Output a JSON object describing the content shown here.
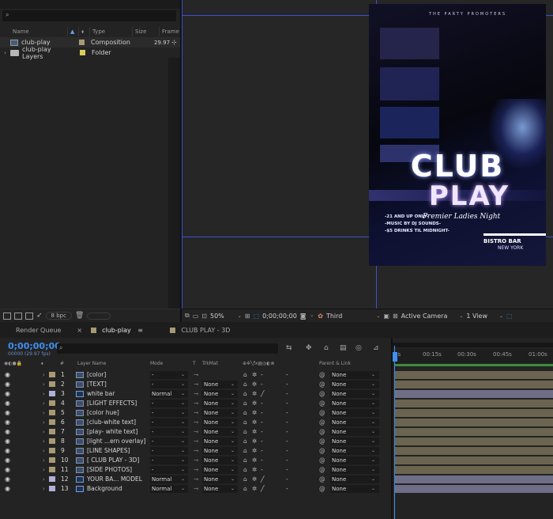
{
  "project": {
    "search_placeholder": "",
    "columns": {
      "name": "Name",
      "type": "Type",
      "size": "Size",
      "frame_rate": "Frame Ra..."
    },
    "items": [
      {
        "name": "club-play",
        "color": "#a89a74",
        "type": "Composition",
        "frame_rate": "29.97",
        "icon": "composition-icon"
      },
      {
        "name": "club-play Layers",
        "color": "#d8cf58",
        "type": "Folder",
        "frame_rate": "",
        "icon": "folder-icon"
      }
    ],
    "bpc": "8 bpc"
  },
  "viewer": {
    "zoom": "50%",
    "timecode": "0;00;00;00",
    "resolution": "Third",
    "camera": "Active Camera",
    "views": "1 View"
  },
  "poster": {
    "promoter": "THE PARTY PROMOTERS",
    "club": "CLUB",
    "play": "PLAY",
    "subtitle": "Premier Ladies Night",
    "line1": "-21 AND UP ONLY-",
    "line2": "-MUSIC BY DJ SOUNDS-",
    "line3": "-$5 DRINKS TIL MIDNIGHT-",
    "venue": "BISTRO BAR",
    "city": "NEW YORK"
  },
  "tabs": [
    {
      "label": "Render Queue",
      "color": "",
      "active": false
    },
    {
      "label": "club-play",
      "color": "#a89a74",
      "active": true
    },
    {
      "label": "CLUB PLAY - 3D",
      "color": "#a89a74",
      "active": false
    }
  ],
  "timeline": {
    "timecode": "0;00;00;00",
    "frames": "00000 (29.97 fps)",
    "headers": {
      "num": "#",
      "layer_name": "Layer Name",
      "mode": "Mode",
      "t": "T",
      "trkmat": "TrkMat",
      "parent": "Parent & Link"
    },
    "ruler": [
      "0s",
      "00:15s",
      "00:30s",
      "00:45s",
      "01:00s"
    ],
    "layers": [
      {
        "num": "1",
        "name": "[color]",
        "mode": "-",
        "trkmat": "",
        "parent": "None",
        "color": "#a89a74",
        "icon": "comp"
      },
      {
        "num": "2",
        "name": "[TEXT]",
        "mode": "-",
        "trkmat": "None",
        "parent": "None",
        "color": "#a89a74",
        "icon": "comp"
      },
      {
        "num": "3",
        "name": "white bar",
        "mode": "Normal",
        "trkmat": "None",
        "parent": "None",
        "color": "#b0b0d8",
        "icon": "text"
      },
      {
        "num": "4",
        "name": "[LIGHT EFFECTS]",
        "mode": "-",
        "trkmat": "None",
        "parent": "None",
        "color": "#a89a74",
        "icon": "comp"
      },
      {
        "num": "5",
        "name": "[color hue]",
        "mode": "-",
        "trkmat": "None",
        "parent": "None",
        "color": "#a89a74",
        "icon": "comp"
      },
      {
        "num": "6",
        "name": "[club-white text]",
        "mode": "-",
        "trkmat": "None",
        "parent": "None",
        "color": "#a89a74",
        "icon": "comp"
      },
      {
        "num": "7",
        "name": "[play- white text]",
        "mode": "-",
        "trkmat": "None",
        "parent": "None",
        "color": "#a89a74",
        "icon": "comp"
      },
      {
        "num": "8",
        "name": "[light ...ern overlay]",
        "mode": "-",
        "trkmat": "None",
        "parent": "None",
        "color": "#a89a74",
        "icon": "comp"
      },
      {
        "num": "9",
        "name": "[LINE SHAPES]",
        "mode": "-",
        "trkmat": "None",
        "parent": "None",
        "color": "#a89a74",
        "icon": "comp"
      },
      {
        "num": "10",
        "name": "[ CLUB PLAY - 3D]",
        "mode": "-",
        "trkmat": "None",
        "parent": "None",
        "color": "#a89a74",
        "icon": "comp"
      },
      {
        "num": "11",
        "name": "[SIDE PHOTOS]",
        "mode": "-",
        "trkmat": "None",
        "parent": "None",
        "color": "#a89a74",
        "icon": "comp"
      },
      {
        "num": "12",
        "name": "YOUR BA... MODEL",
        "mode": "Normal",
        "trkmat": "None",
        "parent": "None",
        "color": "#b0b0d8",
        "icon": "text"
      },
      {
        "num": "13",
        "name": "Background",
        "mode": "Normal",
        "trkmat": "None",
        "parent": "None",
        "color": "#b0b0d8",
        "icon": "text"
      }
    ]
  }
}
